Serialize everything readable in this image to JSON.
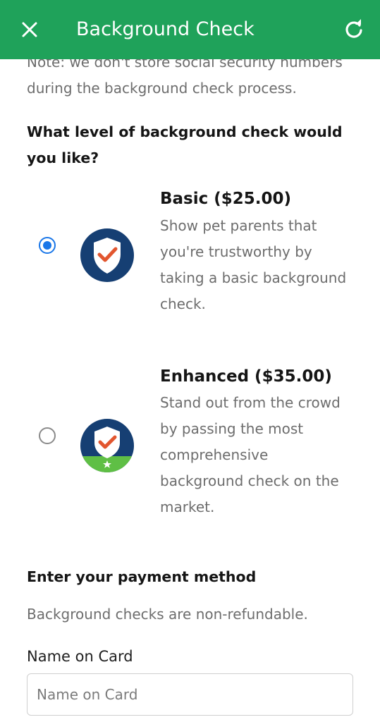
{
  "appbar": {
    "title": "Background Check",
    "close_icon": "close-icon",
    "refresh_icon": "refresh-icon",
    "color": "#1fa25a"
  },
  "note": "Note: we don't store social security numbers during the background check process.",
  "question": "What level of background check would you like?",
  "options": [
    {
      "title": "Basic ($25.00)",
      "description": "Show pet parents that you're trustworthy by taking a basic background check.",
      "selected": true,
      "icon": "shield-check-icon"
    },
    {
      "title": "Enhanced ($35.00)",
      "description": "Stand out from the crowd by passing the most comprehensive background check on the market.",
      "selected": false,
      "icon": "shield-check-star-icon"
    }
  ],
  "payment": {
    "title": "Enter your payment method",
    "note": "Background checks are non-refundable.",
    "name_label": "Name on Card",
    "name_placeholder": "Name on Card",
    "name_value": ""
  },
  "colors": {
    "accent_blue": "#1976e8",
    "shield_navy": "#163f73",
    "check_orange": "#e2562f",
    "enhanced_green": "#5fbf45"
  }
}
